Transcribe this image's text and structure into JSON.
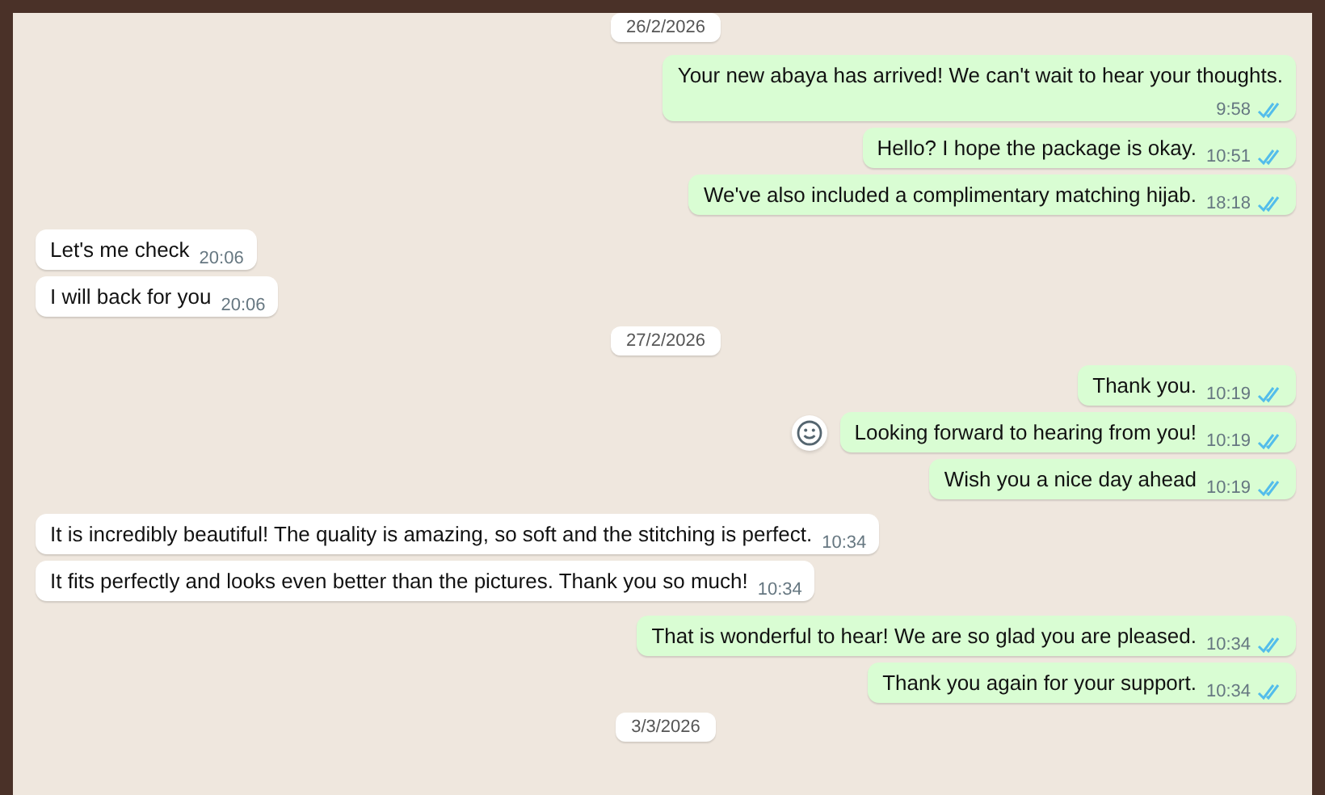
{
  "messages": [
    {
      "kind": "date",
      "text": "26/2/2026"
    },
    {
      "kind": "out",
      "text": "Your new abaya has arrived! We can't wait to hear your thoughts.",
      "time": "9:58",
      "read": true,
      "time_below": true,
      "hovered": false
    },
    {
      "kind": "out",
      "text": "Hello? I hope the package is okay.",
      "time": "10:51",
      "read": true,
      "time_below": false,
      "hovered": false
    },
    {
      "kind": "out",
      "text": "We've also included a complimentary matching hijab.",
      "time": "18:18",
      "read": true,
      "time_below": false,
      "hovered": false
    },
    {
      "kind": "in",
      "text": "Let's me check",
      "time": "20:06",
      "time_below": false,
      "hovered": false
    },
    {
      "kind": "in",
      "text": "I will  back for you",
      "time": "20:06",
      "time_below": false,
      "hovered": false
    },
    {
      "kind": "date",
      "text": "27/2/2026"
    },
    {
      "kind": "out",
      "text": "Thank you.",
      "time": "10:19",
      "read": true,
      "time_below": false,
      "hovered": false
    },
    {
      "kind": "out",
      "text": "Looking forward to hearing from you!",
      "time": "10:19",
      "read": true,
      "time_below": false,
      "hovered": true
    },
    {
      "kind": "out",
      "text": "Wish you a nice day ahead",
      "time": "10:19",
      "read": true,
      "time_below": false,
      "hovered": false
    },
    {
      "kind": "in",
      "text": "It is incredibly beautiful! The quality is amazing, so soft and the stitching is perfect.",
      "time": "10:34",
      "time_below": false,
      "hovered": false
    },
    {
      "kind": "in",
      "text": "It fits perfectly and looks even better than the pictures. Thank you so much!",
      "time": "10:34",
      "time_below": false,
      "hovered": false
    },
    {
      "kind": "out",
      "text": "That is wonderful to hear! We are so glad you are pleased.",
      "time": "10:34",
      "read": true,
      "time_below": false,
      "hovered": false
    },
    {
      "kind": "out",
      "text": "Thank you again for your support.",
      "time": "10:34",
      "read": true,
      "time_below": false,
      "hovered": false
    },
    {
      "kind": "date",
      "text": "3/3/2026"
    }
  ]
}
